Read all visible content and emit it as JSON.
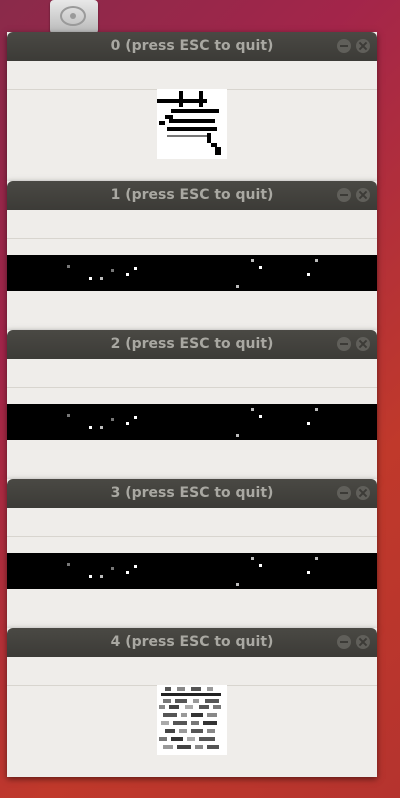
{
  "windows": [
    {
      "title": "0 (press ESC to quit)",
      "content": "symbol-image"
    },
    {
      "title": "1 (press ESC to quit)",
      "content": "dark-strip"
    },
    {
      "title": "2 (press ESC to quit)",
      "content": "dark-strip"
    },
    {
      "title": "3 (press ESC to quit)",
      "content": "dark-strip"
    },
    {
      "title": "4 (press ESC to quit)",
      "content": "noise-image"
    }
  ],
  "icons": {
    "desktop": "drive-icon",
    "minimize": "minimize-icon",
    "close": "close-icon"
  },
  "colors": {
    "titlebar": "#3c3b37",
    "title_text": "#a9a8a2",
    "window_bg": "#efedea",
    "desktop_bg": "#a3254a"
  }
}
